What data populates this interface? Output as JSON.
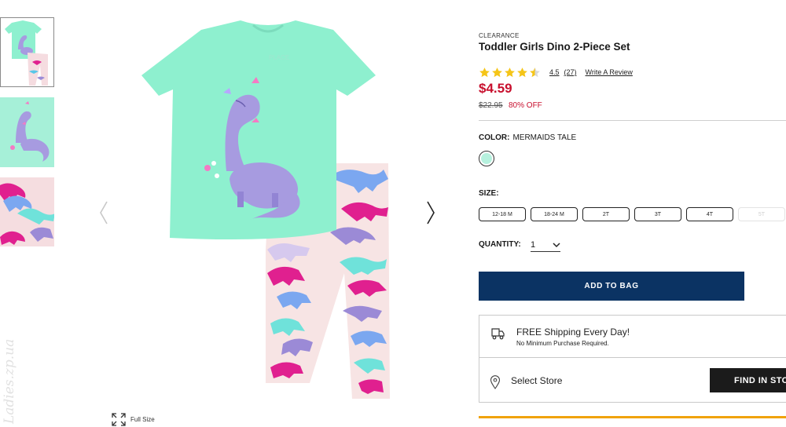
{
  "product": {
    "category_label": "CLEARANCE",
    "title": "Toddler Girls Dino 2-Piece Set",
    "rating_value": "4.5",
    "rating_stars": 4.5,
    "review_count": "(27)",
    "write_review": "Write A Review",
    "sale_price": "$4.59",
    "original_price": "$22.95",
    "discount": "80% OFF",
    "sale_color": "#c8102e"
  },
  "color": {
    "label": "COLOR:",
    "value": "MERMAIDS TALE",
    "swatch_color": "#b6f1de"
  },
  "size": {
    "label": "SIZE:",
    "options": [
      {
        "label": "12-18 M",
        "available": true
      },
      {
        "label": "18-24 M",
        "available": true
      },
      {
        "label": "2T",
        "available": true
      },
      {
        "label": "3T",
        "available": true
      },
      {
        "label": "4T",
        "available": true
      },
      {
        "label": "5T",
        "available": false
      }
    ]
  },
  "quantity": {
    "label": "QUANTITY:",
    "value": "1"
  },
  "actions": {
    "add_to_bag": "ADD TO BAG",
    "add_to_bag_color": "#0b3363"
  },
  "shipping": {
    "title": "FREE Shipping Every Day!",
    "subtitle": "No Minimum Purchase Required."
  },
  "store": {
    "select_label": "Select Store",
    "find_label": "FIND IN STORE"
  },
  "gallery": {
    "full_size_label": "Full Size",
    "watermark": "Ladies.zp.ua"
  },
  "icons": {
    "truck": "truck-icon",
    "pin": "map-pin-icon",
    "expand": "expand-icon",
    "prev": "chevron-left-icon",
    "next": "chevron-right-icon",
    "qty": "chevron-down-icon",
    "star": "star-icon"
  }
}
